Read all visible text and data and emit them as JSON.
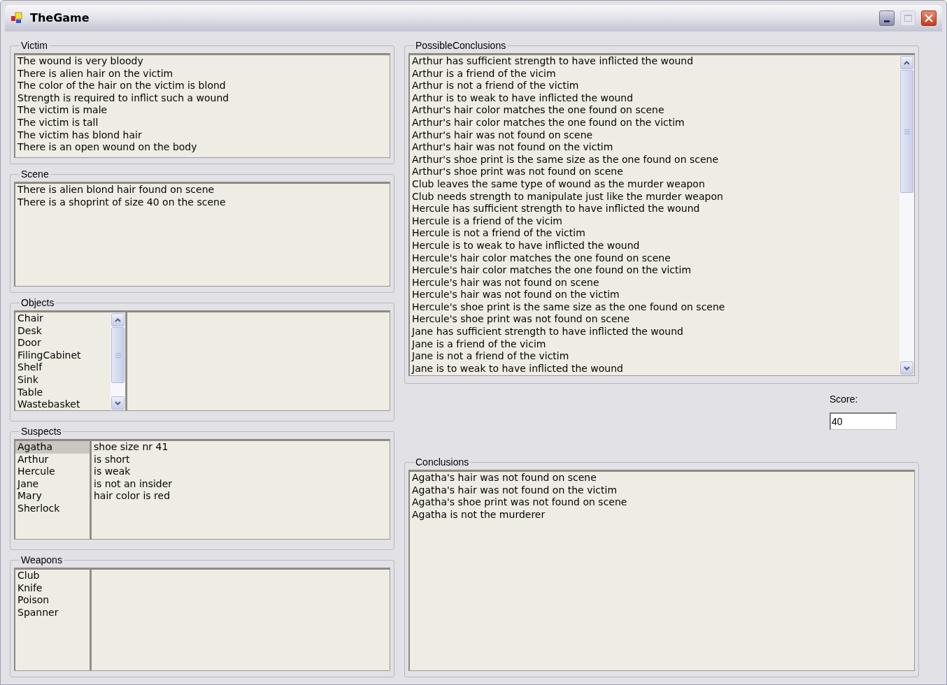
{
  "window": {
    "title": "TheGame"
  },
  "victim": {
    "title": "Victim",
    "lines": [
      "The wound is very bloody",
      "There is alien hair on the victim",
      "The color of the hair on the victim is blond",
      "Strength is required to inflict such a wound",
      "The victim is male",
      "The victim is tall",
      "The victim has blond hair",
      "There is an open wound on the body"
    ]
  },
  "scene": {
    "title": "Scene",
    "lines": [
      "There is alien blond hair found on scene",
      "There is a shoprint of size 40 on the scene"
    ]
  },
  "objects": {
    "title": "Objects",
    "items": [
      {
        "label": "Chair",
        "selected": false
      },
      {
        "label": "Desk",
        "selected": false
      },
      {
        "label": "Door",
        "selected": false
      },
      {
        "label": "FilingCabinet",
        "selected": false
      },
      {
        "label": "Shelf",
        "selected": false
      },
      {
        "label": "Sink",
        "selected": false
      },
      {
        "label": "Table",
        "selected": false
      },
      {
        "label": "Wastebasket",
        "selected": false
      }
    ]
  },
  "suspects": {
    "title": "Suspects",
    "items": [
      {
        "label": "Agatha",
        "selected": true
      },
      {
        "label": "Arthur",
        "selected": false
      },
      {
        "label": "Hercule",
        "selected": false
      },
      {
        "label": "Jane",
        "selected": false
      },
      {
        "label": "Mary",
        "selected": false
      },
      {
        "label": "Sherlock",
        "selected": false
      }
    ],
    "details": [
      "shoe size nr 41",
      "is short",
      "is weak",
      "is not an insider",
      "hair color is red"
    ]
  },
  "weapons": {
    "title": "Weapons",
    "items": [
      {
        "label": "Club",
        "selected": false
      },
      {
        "label": "Knife",
        "selected": false
      },
      {
        "label": "Poison",
        "selected": false
      },
      {
        "label": "Spanner",
        "selected": false
      }
    ]
  },
  "possible_conclusions": {
    "title": "PossibleConclusions",
    "lines": [
      "Arthur has sufficient strength to have inflicted the wound",
      "Arthur is a friend of the vicim",
      "Arthur is not a friend of the victim",
      "Arthur is to weak to have inflicted the wound",
      "Arthur's hair color matches the one found on scene",
      "Arthur's hair color matches the one found on the victim",
      "Arthur's hair was not found on scene",
      "Arthur's hair was not found on the victim",
      "Arthur's shoe print is the same size as the one found on scene",
      "Arthur's shoe print was not found on scene",
      "Club leaves the same type of wound as the murder weapon",
      "Club needs strength to manipulate just like the murder weapon",
      "Hercule has sufficient strength to have inflicted the wound",
      "Hercule is a friend of the vicim",
      "Hercule is not a friend of the victim",
      "Hercule is to weak to have inflicted the wound",
      "Hercule's hair color matches the one found on scene",
      "Hercule's hair color matches the one found on the victim",
      "Hercule's hair was not found on scene",
      "Hercule's hair was not found on the victim",
      "Hercule's shoe print is the same size as the one found on scene",
      "Hercule's shoe print was not found on scene",
      "Jane has sufficient strength to have inflicted the wound",
      "Jane is a friend of the vicim",
      "Jane is not a friend of the victim",
      "Jane is to weak to have inflicted the wound"
    ]
  },
  "score": {
    "label": "Score:",
    "value": "40"
  },
  "conclusions": {
    "title": "Conclusions",
    "lines": [
      "Agatha's hair was not found on scene",
      "Agatha's hair was not found on the victim",
      "Agatha's shoe print was not found on scene",
      "Agatha is not the murderer"
    ]
  }
}
